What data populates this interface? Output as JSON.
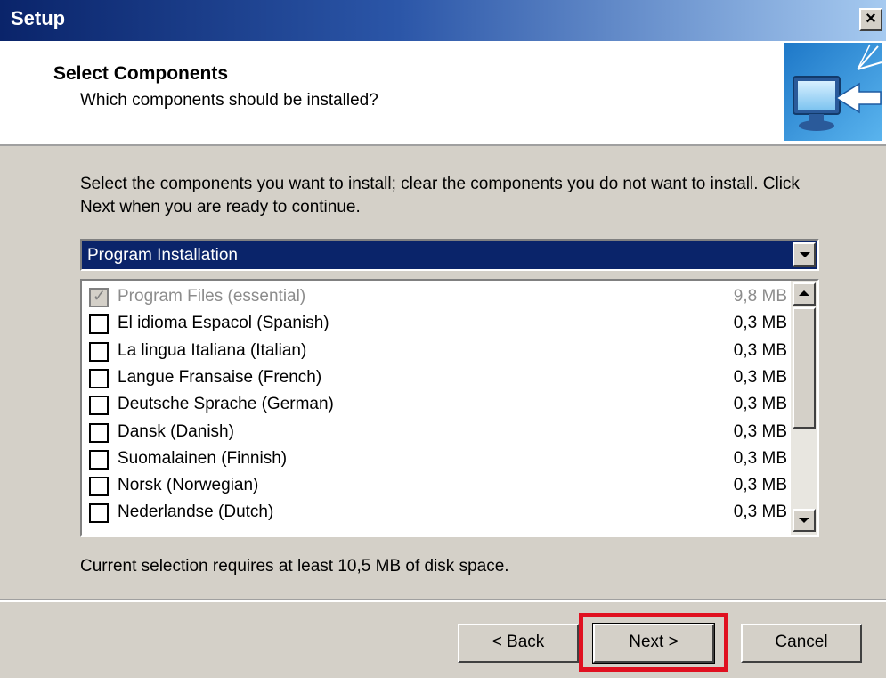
{
  "window": {
    "title": "Setup",
    "close_label": "×"
  },
  "header": {
    "title": "Select Components",
    "subtitle": "Which components should be installed?"
  },
  "instructions": "Select the components you want to install; clear the components you do not want to install. Click Next when you are ready to continue.",
  "dropdown": {
    "selected": "Program Installation"
  },
  "components": [
    {
      "label": "Program Files (essential)",
      "size": "9,8 MB",
      "checked": true,
      "disabled": true
    },
    {
      "label": "El idioma Espacol (Spanish)",
      "size": "0,3 MB",
      "checked": false,
      "disabled": false
    },
    {
      "label": "La lingua Italiana (Italian)",
      "size": "0,3 MB",
      "checked": false,
      "disabled": false
    },
    {
      "label": "Langue Fransaise (French)",
      "size": "0,3 MB",
      "checked": false,
      "disabled": false
    },
    {
      "label": "Deutsche Sprache (German)",
      "size": "0,3 MB",
      "checked": false,
      "disabled": false
    },
    {
      "label": "Dansk (Danish)",
      "size": "0,3 MB",
      "checked": false,
      "disabled": false
    },
    {
      "label": "Suomalainen (Finnish)",
      "size": "0,3 MB",
      "checked": false,
      "disabled": false
    },
    {
      "label": "Norsk (Norwegian)",
      "size": "0,3 MB",
      "checked": false,
      "disabled": false
    },
    {
      "label": "Nederlandse (Dutch)",
      "size": "0,3 MB",
      "checked": false,
      "disabled": false
    }
  ],
  "disk_space": "Current selection requires at least 10,5 MB of disk space.",
  "buttons": {
    "back": "< Back",
    "next": "Next >",
    "cancel": "Cancel"
  },
  "colors": {
    "highlight": "#e01020",
    "title_bar": "#0a246a"
  }
}
